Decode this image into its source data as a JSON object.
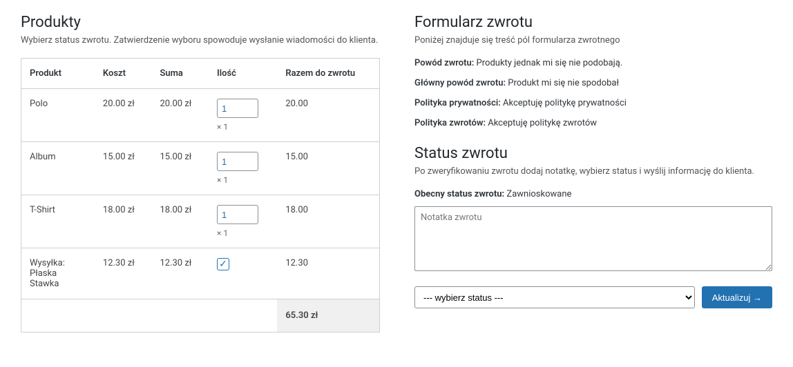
{
  "products": {
    "title": "Produkty",
    "subtitle": "Wybierz status zwrotu. Zatwierdzenie wyboru spowoduje wysłanie wiadomości do klienta.",
    "columns": {
      "product": "Produkt",
      "cost": "Koszt",
      "sum": "Suma",
      "qty": "Ilość",
      "total_return": "Razem do zwrotu"
    },
    "rows": [
      {
        "name": "Polo",
        "cost": "20.00 zł",
        "sum": "20.00 zł",
        "qty_value": "1",
        "qty_note": "× 1",
        "total": "20.00",
        "is_checkbox": false
      },
      {
        "name": "Album",
        "cost": "15.00 zł",
        "sum": "15.00 zł",
        "qty_value": "1",
        "qty_note": "× 1",
        "total": "15.00",
        "is_checkbox": false
      },
      {
        "name": "T-Shirt",
        "cost": "18.00 zł",
        "sum": "18.00 zł",
        "qty_value": "1",
        "qty_note": "× 1",
        "total": "18.00",
        "is_checkbox": false
      },
      {
        "name": "Wysyłka: Płaska Stawka",
        "cost": "12.30 zł",
        "sum": "12.30 zł",
        "qty_value": "",
        "qty_note": "",
        "total": "12.30",
        "is_checkbox": true,
        "checked": true
      }
    ],
    "grand_total": "65.30 zł"
  },
  "form": {
    "title": "Formularz zwrotu",
    "subtitle": "Poniżej znajduje się treść pól formularza zwrotnego",
    "fields": [
      {
        "label": "Powód zwrotu:",
        "value": "Produkty jednak mi się nie podobają."
      },
      {
        "label": "Główny powód zwrotu:",
        "value": "Produkt mi się nie spodobał"
      },
      {
        "label": "Polityka prywatności:",
        "value": "Akceptuję politykę prywatności"
      },
      {
        "label": "Polityka zwrotów:",
        "value": "Akceptuję politykę zwrotów"
      }
    ]
  },
  "status": {
    "title": "Status zwrotu",
    "subtitle": "Po zweryfikowaniu zwrotu dodaj notatkę, wybierz status i wyślij informację do klienta.",
    "current_label": "Obecny status zwrotu:",
    "current_value": "Zawnioskowane",
    "note_placeholder": "Notatka zwrotu",
    "select_placeholder": "--- wybierz status ---",
    "update_button": "Aktualizuj →"
  }
}
